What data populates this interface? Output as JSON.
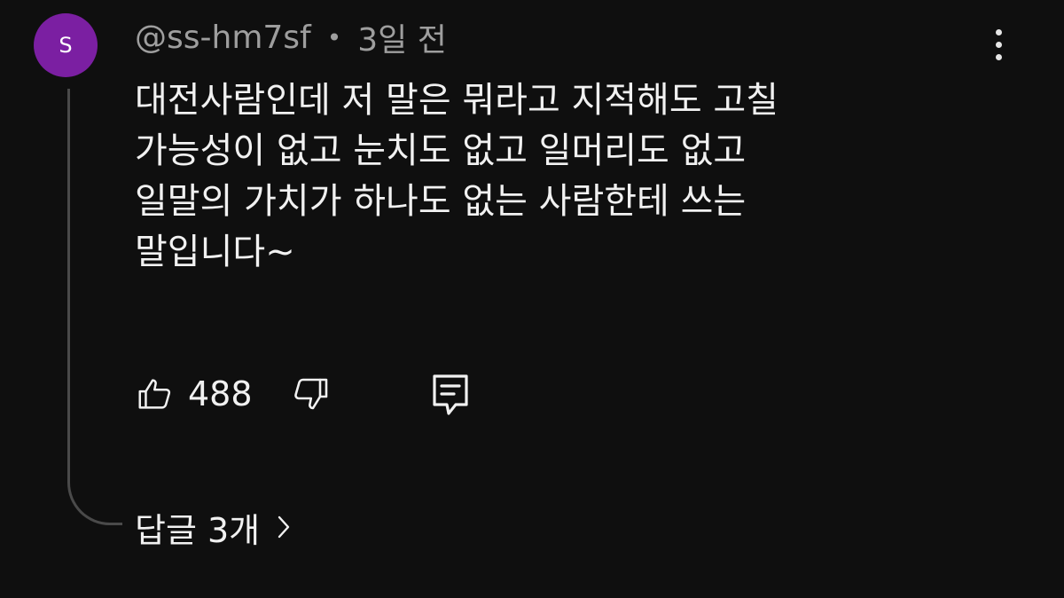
{
  "comment": {
    "avatar_letter": "S",
    "author": "@ss-hm7sf",
    "separator": "•",
    "time": "3일 전",
    "text_lines": [
      "대전사람인데 저 말은 뭐라고 지적해도 고칠",
      "가능성이 없고 눈치도 없고 일머리도 없고",
      "일말의 가치가 하나도 없는 사람한테 쓰는",
      "말입니다~"
    ],
    "like_count": "488",
    "replies_label": "답글 3개"
  },
  "colors": {
    "background": "#0f0f0f",
    "avatar": "#7b1fa2",
    "text": "#f1f1f1",
    "meta_text": "#9e9e9e",
    "thread_line": "#4a4a4a"
  },
  "icons": {
    "like": "thumbs-up-icon",
    "dislike": "thumbs-down-icon",
    "reply": "comment-icon",
    "more": "more-vertical-icon",
    "chevron": "chevron-right-icon"
  }
}
